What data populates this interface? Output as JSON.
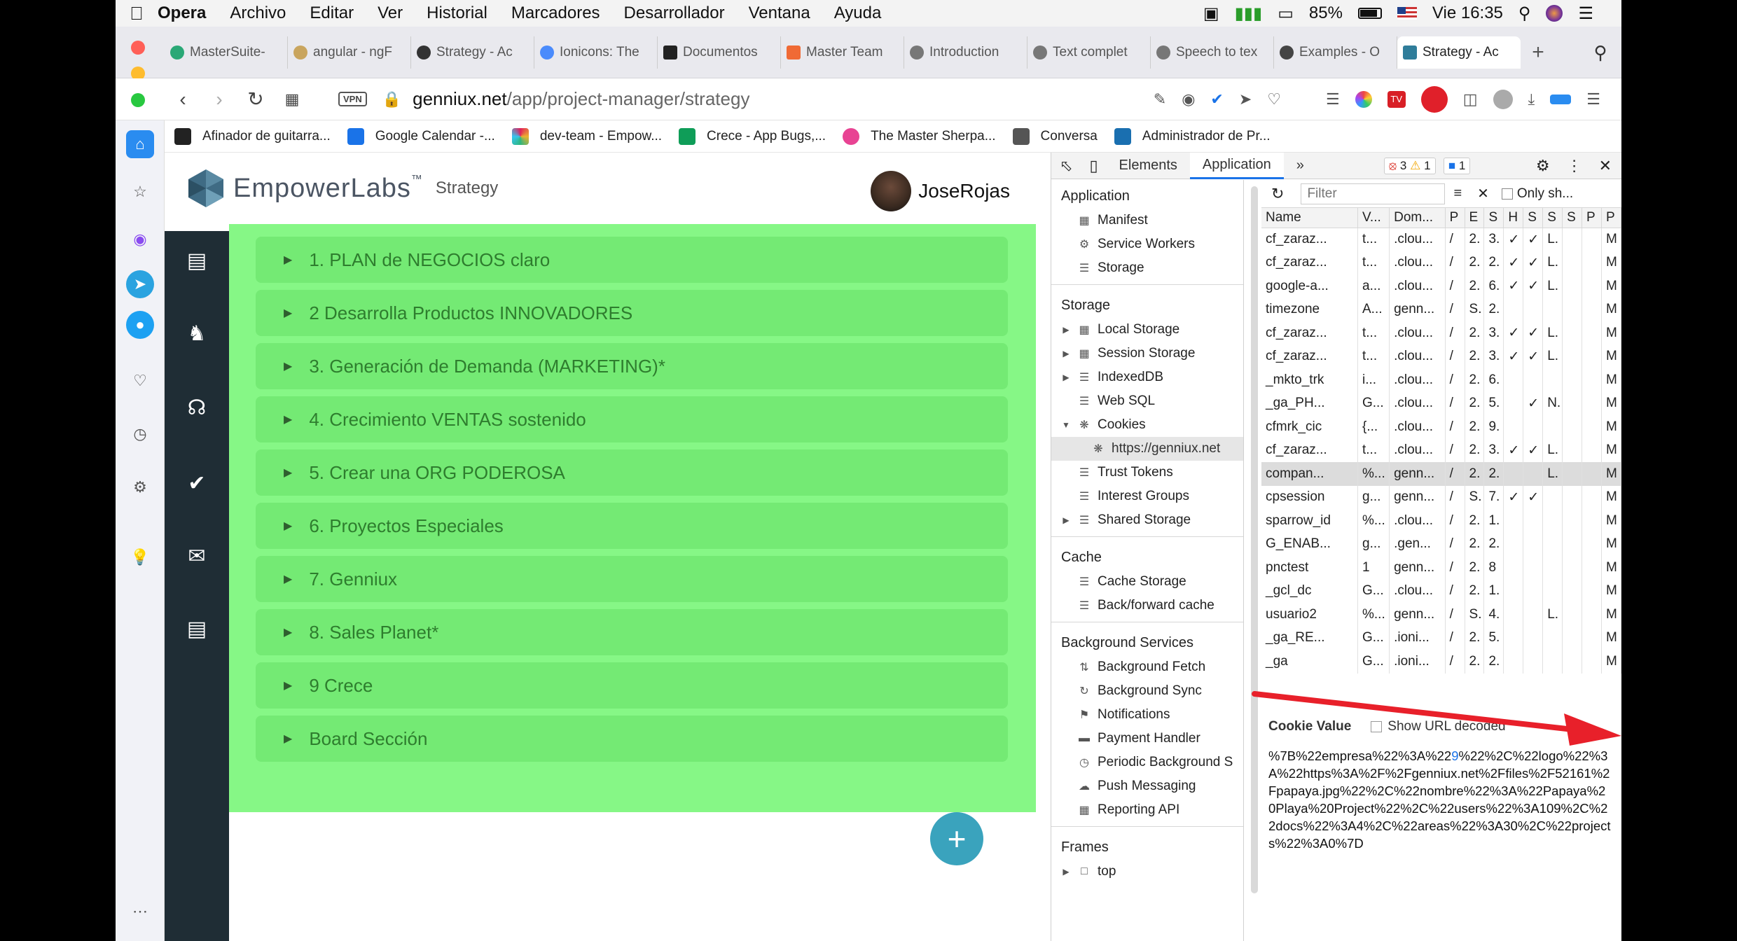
{
  "menubar": {
    "items": [
      "Opera",
      "Archivo",
      "Editar",
      "Ver",
      "Historial",
      "Marcadores",
      "Desarrollador",
      "Ventana",
      "Ayuda"
    ],
    "battery": "85%",
    "clock": "Vie 16:35"
  },
  "tabs": [
    {
      "label": "MasterSuite-"
    },
    {
      "label": "angular - ngF"
    },
    {
      "label": "Strategy - Ac"
    },
    {
      "label": "Ionicons: The"
    },
    {
      "label": "Documentos"
    },
    {
      "label": "Master Team"
    },
    {
      "label": "Introduction"
    },
    {
      "label": "Text complet"
    },
    {
      "label": "Speech to tex"
    },
    {
      "label": "Examples - O"
    },
    {
      "label": "Strategy - Ac"
    }
  ],
  "address": {
    "vpn": "VPN",
    "host": "genniux.net",
    "path": "/app/project-manager/strategy"
  },
  "bookmarks": [
    {
      "label": "Afinador de guitarra...",
      "color": "#222"
    },
    {
      "label": "Google Calendar -...",
      "color": "#1a73e8"
    },
    {
      "label": "dev-team - Empow...",
      "color": "#e01e5a"
    },
    {
      "label": "Crece - App Bugs,...",
      "color": "#0f9d58"
    },
    {
      "label": "The Master Sherpa...",
      "color": "#e84393"
    },
    {
      "label": "Conversa",
      "color": "#555"
    },
    {
      "label": "Administrador de Pr...",
      "color": "#1a6fb0"
    }
  ],
  "app": {
    "brand": "EmpowerLabs",
    "tm": "™",
    "subtitle": "Strategy",
    "user": "JoseRojas",
    "items": [
      "1. PLAN de NEGOCIOS claro",
      "2 Desarrolla Productos INNOVADORES",
      "3. Generación de Demanda (MARKETING)*",
      "4. Crecimiento VENTAS sostenido",
      "5. Crear una ORG PODEROSA",
      "6. Proyectos Especiales",
      "7. Genniux",
      "8. Sales Planet*",
      "9 Crece",
      "Board Sección"
    ],
    "fab": "+"
  },
  "devtools": {
    "tabs": [
      "Elements",
      "Application"
    ],
    "errors": "3",
    "warnings": "1",
    "messages": "1",
    "filter_placeholder": "Filter",
    "only_show": "Only sh...",
    "sections": {
      "application": {
        "title": "Application",
        "items": [
          "Manifest",
          "Service Workers",
          "Storage"
        ]
      },
      "storage": {
        "title": "Storage",
        "items": [
          "Local Storage",
          "Session Storage",
          "IndexedDB",
          "Web SQL",
          "Cookies",
          "https://genniux.net",
          "Trust Tokens",
          "Interest Groups",
          "Shared Storage"
        ]
      },
      "cache": {
        "title": "Cache",
        "items": [
          "Cache Storage",
          "Back/forward cache"
        ]
      },
      "background": {
        "title": "Background Services",
        "items": [
          "Background Fetch",
          "Background Sync",
          "Notifications",
          "Payment Handler",
          "Periodic Background S",
          "Push Messaging",
          "Reporting API"
        ]
      },
      "frames": {
        "title": "Frames",
        "items": [
          "top"
        ]
      }
    },
    "columns": [
      "Name",
      "V...",
      "Dom...",
      "P",
      "E",
      "S",
      "H",
      "S",
      "S",
      "S",
      "P",
      "P"
    ],
    "rows": [
      [
        "cf_zaraz...",
        "t...",
        ".clou...",
        "/",
        "2.",
        "3.",
        "✓",
        "✓",
        "L.",
        "",
        "",
        "M"
      ],
      [
        "cf_zaraz...",
        "t...",
        ".clou...",
        "/",
        "2.",
        "2.",
        "✓",
        "✓",
        "L.",
        "",
        "",
        "M"
      ],
      [
        "google-a...",
        "a...",
        ".clou...",
        "/",
        "2.",
        "6.",
        "✓",
        "✓",
        "L.",
        "",
        "",
        "M"
      ],
      [
        "timezone",
        "A...",
        "genn...",
        "/",
        "S.",
        "2.",
        "",
        "",
        "",
        "",
        "",
        "M"
      ],
      [
        "cf_zaraz...",
        "t...",
        ".clou...",
        "/",
        "2.",
        "3.",
        "✓",
        "✓",
        "L.",
        "",
        "",
        "M"
      ],
      [
        "cf_zaraz...",
        "t...",
        ".clou...",
        "/",
        "2.",
        "3.",
        "✓",
        "✓",
        "L.",
        "",
        "",
        "M"
      ],
      [
        "_mkto_trk",
        "i...",
        ".clou...",
        "/",
        "2.",
        "6.",
        "",
        "",
        "",
        "",
        "",
        "M"
      ],
      [
        "_ga_PH...",
        "G...",
        ".clou...",
        "/",
        "2.",
        "5.",
        "",
        "✓",
        "N.",
        "",
        "",
        "M"
      ],
      [
        "cfmrk_cic",
        "{...",
        ".clou...",
        "/",
        "2.",
        "9.",
        "",
        "",
        "",
        "",
        "",
        "M"
      ],
      [
        "cf_zaraz...",
        "t...",
        ".clou...",
        "/",
        "2.",
        "3.",
        "✓",
        "✓",
        "L.",
        "",
        "",
        "M"
      ],
      [
        "compan...",
        "%...",
        "genn...",
        "/",
        "2.",
        "2.",
        "",
        "",
        "L.",
        "",
        "",
        "M"
      ],
      [
        "cpsession",
        "g...",
        "genn...",
        "/",
        "S.",
        "7.",
        "✓",
        "✓",
        "",
        "",
        "",
        "M"
      ],
      [
        "sparrow_id",
        "%...",
        ".clou...",
        "/",
        "2.",
        "1.",
        "",
        "",
        "",
        "",
        "",
        "M"
      ],
      [
        "G_ENAB...",
        "g...",
        ".gen...",
        "/",
        "2.",
        "2.",
        "",
        "",
        "",
        "",
        "",
        "M"
      ],
      [
        "pnctest",
        "1",
        "genn...",
        "/",
        "2.",
        "8",
        "",
        "",
        "",
        "",
        "",
        "M"
      ],
      [
        "_gcl_dc",
        "G...",
        ".clou...",
        "/",
        "2.",
        "1.",
        "",
        "",
        "",
        "",
        "",
        "M"
      ],
      [
        "usuario2",
        "%...",
        "genn...",
        "/",
        "S.",
        "4.",
        "",
        "",
        "L.",
        "",
        "",
        "M"
      ],
      [
        "_ga_RE...",
        "G...",
        ".ioni...",
        "/",
        "2.",
        "5.",
        "",
        "",
        "",
        "",
        "",
        "M"
      ],
      [
        "_ga",
        "G...",
        ".ioni...",
        "/",
        "2.",
        "2.",
        "",
        "",
        "",
        "",
        "",
        "M"
      ]
    ],
    "cookie_value_label": "Cookie Value",
    "show_url_decoded": "Show URL decoded",
    "cookie_value_pre": "%7B%22empresa%22%3A%22",
    "cookie_value_hl": "9",
    "cookie_value_post": "%22%2C%22logo%22%3A%22https%3A%2F%2Fgenniux.net%2Ffiles%2F52161%2Fpapaya.jpg%22%2C%22nombre%22%3A%22Papaya%20Playa%20Project%22%2C%22users%22%3A109%2C%22docs%22%3A4%2C%22areas%22%3A30%2C%22projects%22%3A0%7D",
    "arrow_color": "#e8202a"
  }
}
